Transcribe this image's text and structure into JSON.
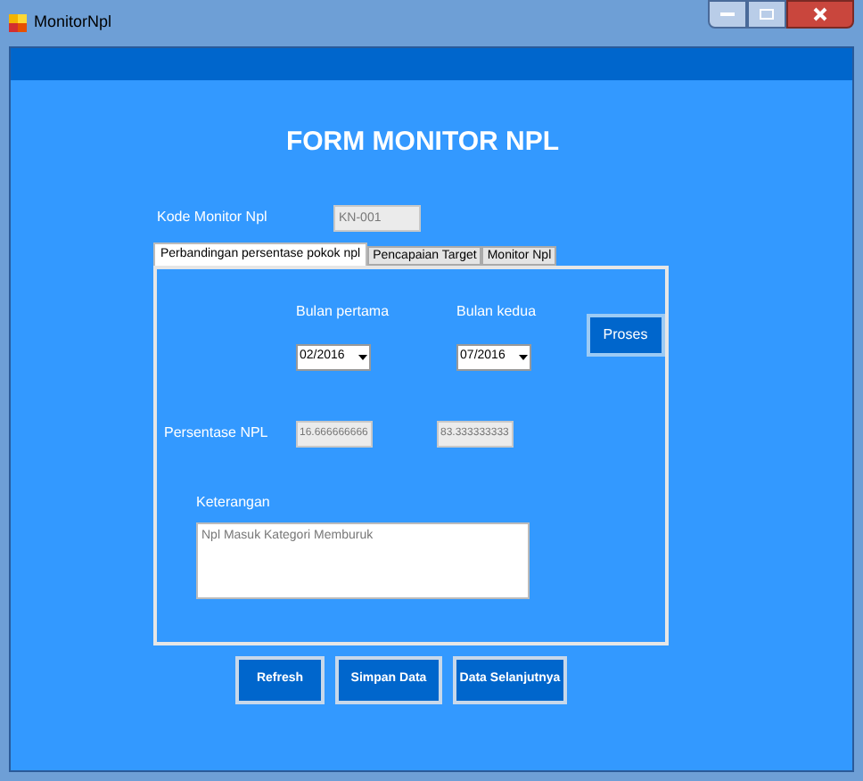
{
  "window": {
    "title": "MonitorNpl"
  },
  "heading": "FORM MONITOR NPL",
  "kode": {
    "label": "Kode Monitor Npl",
    "value": "KN-001"
  },
  "tabs": [
    {
      "label": "Perbandingan persentase pokok npl",
      "selected": true
    },
    {
      "label": "Pencapaian Target",
      "selected": false
    },
    {
      "label": "Monitor Npl",
      "selected": false
    }
  ],
  "months": [
    {
      "label": "Bulan pertama",
      "value": "02/2016"
    },
    {
      "label": "Bulan kedua",
      "value": "07/2016"
    }
  ],
  "process_button": "Proses",
  "persentase": {
    "label": "Persentase NPL",
    "values": [
      "16.666666666",
      "83.333333333"
    ]
  },
  "keterangan": {
    "label": "Keterangan",
    "value": "Npl Masuk Kategori Memburuk"
  },
  "buttons": [
    "Refresh",
    "Simpan Data",
    "Data Selanjutnya"
  ]
}
